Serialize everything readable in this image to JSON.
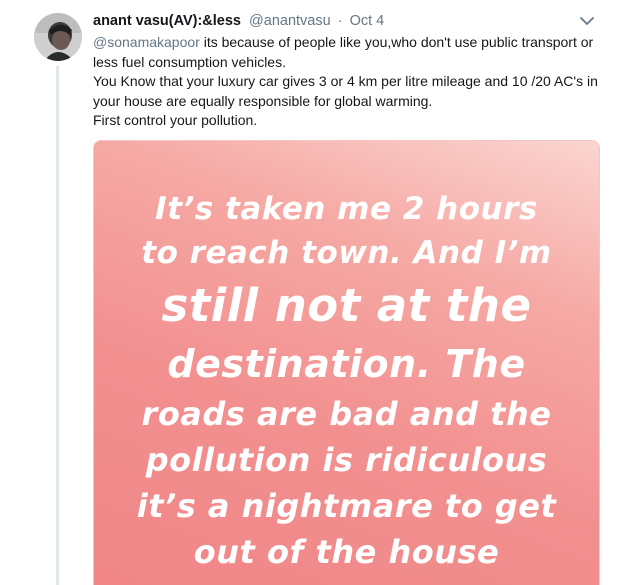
{
  "tweet": {
    "author_name": "anant vasu(AV):&less",
    "handle": "@anantvasu",
    "separator": "·",
    "date": "Oct 4",
    "mention": "@sonamakapoor",
    "body_line1_rest": " its because of people like you,who don't use public transport or less fuel consumption vehicles.",
    "body_line2": "You Know that your luxury car gives 3 or 4 km per litre mileage and  10 /20 AC's in your house are equally responsible for global warming.",
    "body_line3": "First control your pollution."
  },
  "media": {
    "lines": [
      "It’s taken me 2 hours",
      "to reach town. And I’m",
      "still not at the",
      "destination. The",
      "roads are bad and the",
      "pollution is ridiculous",
      "it’s a nightmare to get",
      "out of the house"
    ],
    "gradient_colors": [
      "#fbd5d1",
      "#f6a9a4",
      "#f29090",
      "#f08586"
    ]
  },
  "icons": {
    "menu": "chevron-down-icon",
    "avatar": "avatar"
  }
}
